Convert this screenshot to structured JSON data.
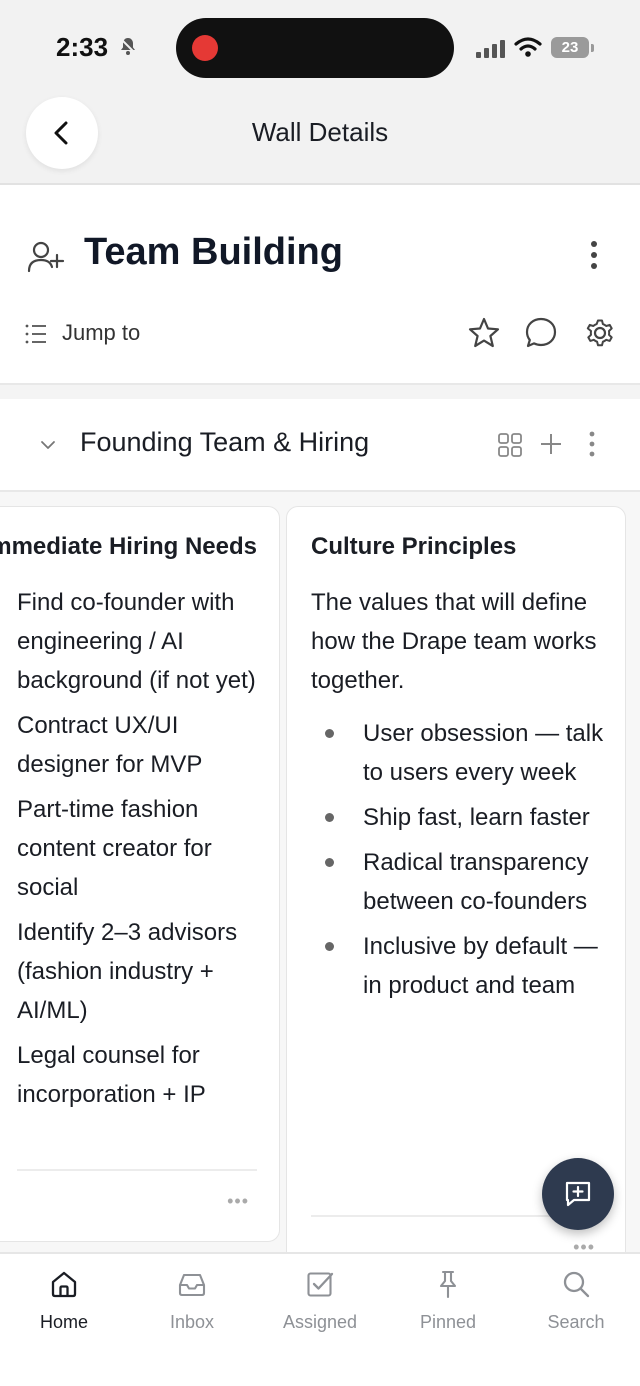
{
  "status_bar": {
    "time": "2:33",
    "battery": "23"
  },
  "nav": {
    "title": "Wall Details"
  },
  "wall": {
    "title": "Team Building",
    "jump_label": "Jump to"
  },
  "section": {
    "title": "Founding Team & Hiring"
  },
  "cards": [
    {
      "title": "Immediate Hiring Needs",
      "items": [
        "Find co-founder with engineering / AI background (if not yet)",
        "Contract UX/UI designer for MVP",
        "Part-time fashion content creator for social",
        "Identify 2–3 advisors (fashion industry + AI/ML)",
        "Legal counsel for incorporation + IP"
      ],
      "more": "•••"
    },
    {
      "title": "Culture Principles",
      "description": "The values that will define how the Drape team works together.",
      "bullets": [
        "User obsession — talk to users every week",
        "Ship fast, learn faster",
        "Radical transparency between co-founders",
        "Inclusive by default — in product and team"
      ],
      "more": "•••"
    }
  ],
  "tabs": [
    {
      "label": "Home",
      "icon": "home-icon",
      "active": true
    },
    {
      "label": "Inbox",
      "icon": "inbox-icon",
      "active": false
    },
    {
      "label": "Assigned",
      "icon": "assigned-icon",
      "active": false
    },
    {
      "label": "Pinned",
      "icon": "pin-icon",
      "active": false
    },
    {
      "label": "Search",
      "icon": "search-icon",
      "active": false
    }
  ],
  "colors": {
    "fab": "#2e3a4f",
    "recording": "#e53935",
    "active_tab": "#1a1d24",
    "inactive_tab": "#8e9196"
  }
}
